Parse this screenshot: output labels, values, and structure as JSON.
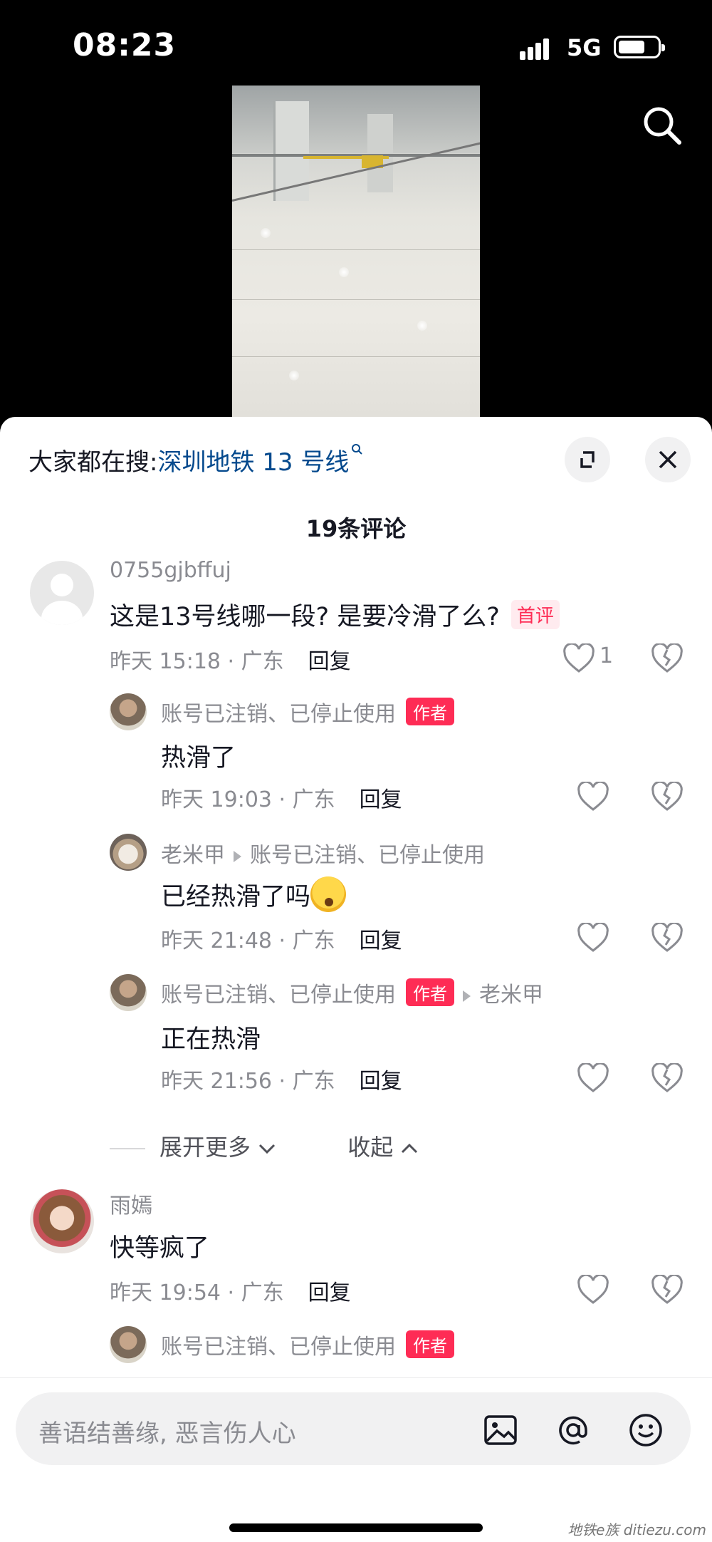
{
  "status_bar": {
    "time": "08:23",
    "network": "5G"
  },
  "search_suggest": {
    "prefix": "大家都在搜:",
    "keyword": "深圳地铁 13 号线"
  },
  "comment_count": "19条评论",
  "comments": [
    {
      "user": "0755gjbffuj",
      "text": "这是13号线哪一段? 是要冷滑了么?",
      "badge": "首评",
      "time": "昨天 15:18 · 广东",
      "reply": "回复",
      "likes": "1",
      "replies": [
        {
          "user": "账号已注销、已停止使用",
          "tag": "作者",
          "text": "热滑了",
          "time": "昨天 19:03 · 广东",
          "reply": "回复"
        },
        {
          "user": "老米甲",
          "reply_to": "账号已注销、已停止使用",
          "text": "已经热滑了吗",
          "time": "昨天 21:48 · 广东",
          "reply": "回复"
        },
        {
          "user": "账号已注销、已停止使用",
          "tag": "作者",
          "reply_to": "老米甲",
          "text": "正在热滑",
          "time": "昨天 21:56 · 广东",
          "reply": "回复"
        }
      ],
      "expand_more": "展开更多",
      "collapse": "收起"
    },
    {
      "user": "雨嫣",
      "text": "快等疯了",
      "time": "昨天 19:54 · 广东",
      "reply": "回复",
      "replies": [
        {
          "user": "账号已注销、已停止使用",
          "tag": "作者"
        }
      ]
    }
  ],
  "input": {
    "placeholder": "善语结善缘, 恶言伤人心"
  },
  "watermark": "地铁e族 ditiezu.com",
  "colors": {
    "accent": "#fe2c55",
    "keyword": "#04498d",
    "text": "#161823",
    "muted": "#8a8b91"
  }
}
